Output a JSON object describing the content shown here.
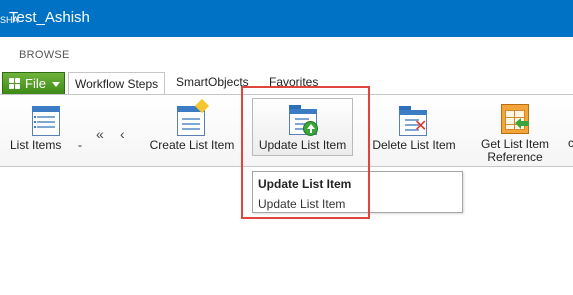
{
  "title_bar": {
    "site_name": "Test_Ashish",
    "fragment": "SHA"
  },
  "browse_bar": {
    "label": "BROWSE"
  },
  "tabs": {
    "file_label": "File",
    "items": [
      {
        "label": "Workflow Steps",
        "active": true
      },
      {
        "label": "SmartObjects",
        "active": false
      },
      {
        "label": "Favorites",
        "active": false
      }
    ]
  },
  "ribbon": {
    "list_items": {
      "label": "List Items",
      "dropdown": "-"
    },
    "nav": {
      "first": "«",
      "prev": "‹"
    },
    "create": {
      "label": "Create List Item"
    },
    "update": {
      "label": "Update List Item"
    },
    "delete": {
      "label": "Delete List Item"
    },
    "get_ref": {
      "line1": "Get List Item",
      "line2": "Reference"
    },
    "edge": "c"
  },
  "tooltip": {
    "title": "Update List Item",
    "description": "Update List Item"
  },
  "colors": {
    "title_bar": "#0072c6",
    "file_button": "#4e9a22",
    "highlight_frame": "#e0453b"
  }
}
